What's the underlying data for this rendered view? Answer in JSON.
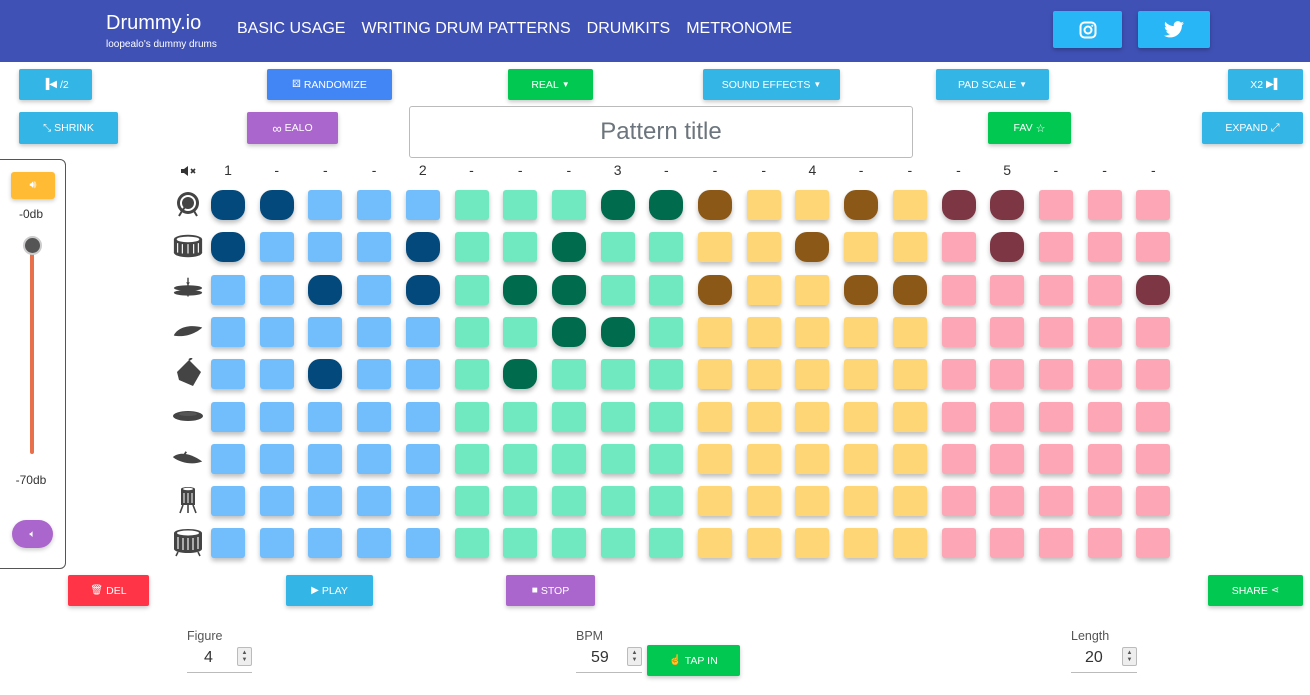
{
  "header": {
    "brand": "Drummy.io",
    "tagline": "loopealo's dummy drums",
    "nav": [
      "BASIC USAGE",
      "WRITING DRUM PATTERNS",
      "DRUMKITS",
      "METRONOME"
    ],
    "social": [
      "instagram-icon",
      "twitter-icon"
    ]
  },
  "toolbar": {
    "half_label": "/2",
    "randomize_label": "RANDOMIZE",
    "kit_label": "REAL",
    "sound_effects_label": "SOUND EFFECTS",
    "pad_scale_label": "PAD SCALE",
    "double_label": "X2",
    "shrink_label": "SHRINK",
    "ealo_label": "EALO",
    "fav_label": "FAV",
    "expand_label": "EXPAND"
  },
  "pattern": {
    "title_placeholder": "Pattern title",
    "title_value": ""
  },
  "volume": {
    "max_label": "-0db",
    "min_label": "-70db",
    "level_db": 0
  },
  "grid": {
    "beat_labels": [
      "1",
      "-",
      "-",
      "-",
      "2",
      "-",
      "-",
      "-",
      "3",
      "-",
      "-",
      "-",
      "4",
      "-",
      "-",
      "-",
      "5",
      "-",
      "-",
      "-"
    ],
    "instruments": [
      "bass-drum-icon",
      "snare-drum-icon",
      "hihat-icon",
      "cymbal-icon",
      "cowbell-icon",
      "clap-icon",
      "ride-icon",
      "tom-icon",
      "floor-tom-icon"
    ],
    "group_colors": {
      "blue": {
        "off": "#72bdfb",
        "on": "#03497c"
      },
      "green": {
        "off": "#70e9c1",
        "on": "#016b4e"
      },
      "yellow": {
        "off": "#fed676",
        "on": "#8b5817"
      },
      "pink": {
        "off": "#fda6b5",
        "on": "#7c3644"
      }
    },
    "active": [
      [
        0,
        1,
        8,
        9,
        10,
        13,
        15,
        16
      ],
      [
        0,
        4,
        7,
        12,
        16
      ],
      [
        2,
        4,
        6,
        7,
        10,
        13,
        14,
        19
      ],
      [
        7,
        8
      ],
      [
        2,
        6
      ],
      [],
      [],
      [],
      []
    ]
  },
  "controls": {
    "del_label": "DEL",
    "play_label": "PLAY",
    "stop_label": "STOP",
    "share_label": "SHARE",
    "tap_label": "TAP IN",
    "figure_label": "Figure",
    "figure_value": "4",
    "bpm_label": "BPM",
    "bpm_value": "59",
    "length_label": "Length",
    "length_value": "20"
  }
}
